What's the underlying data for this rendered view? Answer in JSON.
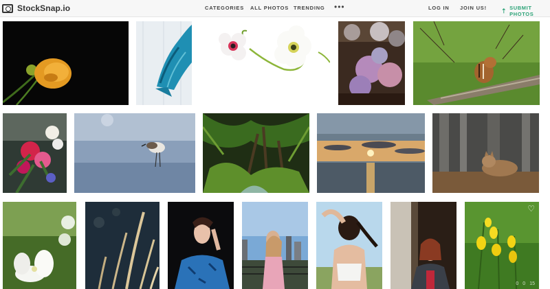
{
  "brand": {
    "name": "StockSnap.io",
    "icon": "camera-icon"
  },
  "nav": {
    "categories": "CATEGORIES",
    "all_photos": "ALL PHOTOS",
    "trending": "TRENDING",
    "more": "•••",
    "login": "LOG IN",
    "join": "JOIN US!",
    "submit": "SUBMIT PHOTOS"
  },
  "colors": {
    "accent": "#2ca377",
    "header_bg": "#f7f7f7",
    "text": "#444444"
  },
  "photos": [
    {
      "subject": "orange flower on black"
    },
    {
      "subject": "blue plaid scarf on white wood"
    },
    {
      "subject": "white anemone flowers"
    },
    {
      "subject": "hydrangea flowers"
    },
    {
      "subject": "chipmunk on log"
    },
    {
      "subject": "flower bouquet"
    },
    {
      "subject": "sandpiper bird on beach"
    },
    {
      "subject": "jungle palm forest"
    },
    {
      "subject": "sunset over sea"
    },
    {
      "subject": "coyote in forest"
    },
    {
      "subject": "white flower"
    },
    {
      "subject": "golden grass"
    },
    {
      "subject": "woman in blue shirt"
    },
    {
      "subject": "woman with city skyline"
    },
    {
      "subject": "woman tying hair"
    },
    {
      "subject": "woman by window"
    },
    {
      "subject": "yellow flowers",
      "stats": {
        "views": "0",
        "likes": "0",
        "downloads": "15"
      }
    }
  ]
}
